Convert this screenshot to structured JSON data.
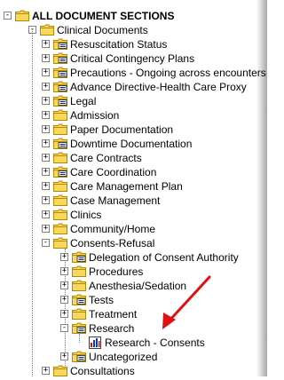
{
  "tree": {
    "root": {
      "label": "ALL DOCUMENT SECTIONS",
      "expanded": true
    },
    "clinical": {
      "label": "Clinical Documents",
      "expanded": true
    },
    "items": [
      {
        "label": "Resuscitation Status",
        "icon": "folder-doc-icon"
      },
      {
        "label": "Critical Contingency Plans",
        "icon": "folder-doc-icon"
      },
      {
        "label": "Precautions - Ongoing across encounters",
        "icon": "folder-doc-icon"
      },
      {
        "label": "Advance Directive-Health Care Proxy",
        "icon": "folder-doc-icon"
      },
      {
        "label": "Legal",
        "icon": "folder-doc-icon"
      },
      {
        "label": "Admission",
        "icon": "folder-icon"
      },
      {
        "label": "Paper Documentation",
        "icon": "folder-icon"
      },
      {
        "label": "Downtime Documentation",
        "icon": "folder-doc-icon"
      },
      {
        "label": "Care Contracts",
        "icon": "folder-icon"
      },
      {
        "label": "Care Coordination",
        "icon": "folder-doc-icon"
      },
      {
        "label": "Care Management Plan",
        "icon": "folder-icon"
      },
      {
        "label": "Case Management",
        "icon": "folder-icon"
      },
      {
        "label": "Clinics",
        "icon": "folder-icon"
      },
      {
        "label": "Community/Home",
        "icon": "folder-icon"
      }
    ],
    "consents": {
      "label": "Consents-Refusal",
      "expanded": true,
      "children": [
        {
          "label": "Delegation of Consent Authority",
          "icon": "folder-doc-icon"
        },
        {
          "label": "Procedures",
          "icon": "folder-icon"
        },
        {
          "label": "Anesthesia/Sedation",
          "icon": "folder-icon"
        },
        {
          "label": "Tests",
          "icon": "folder-doc-icon"
        },
        {
          "label": "Treatment",
          "icon": "folder-icon"
        }
      ],
      "research": {
        "label": "Research",
        "expanded": true,
        "child": {
          "label": "Research - Consents",
          "icon": "chart-doc-icon"
        }
      },
      "uncategorized": {
        "label": "Uncategorized",
        "icon": "folder-doc-icon"
      }
    },
    "consultations": {
      "label": "Consultations"
    }
  },
  "colors": {
    "arrow": "#e01010",
    "folder": "#f6d860",
    "folder_edge": "#b38a00"
  }
}
